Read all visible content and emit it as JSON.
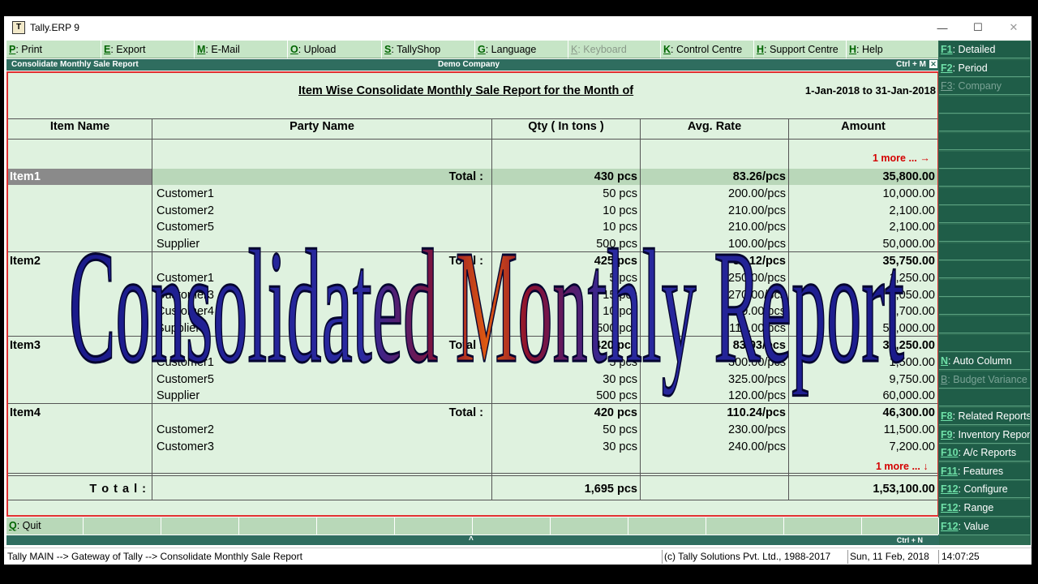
{
  "window": {
    "title": "Tally.ERP 9",
    "app_icon": "tally-icon"
  },
  "toolbar": [
    {
      "key": "P",
      "label": ": Print",
      "width": 117,
      "disabled": false
    },
    {
      "key": "E",
      "label": ": Export",
      "width": 115,
      "disabled": false
    },
    {
      "key": "M",
      "label": ": E-Mail",
      "width": 115,
      "disabled": false
    },
    {
      "key": "O",
      "label": ": Upload",
      "width": 116,
      "disabled": false
    },
    {
      "key": "S",
      "label": ": TallyShop",
      "width": 115,
      "disabled": false
    },
    {
      "key": "G",
      "label": ": Language",
      "width": 115,
      "disabled": false
    },
    {
      "key": "K",
      "label": ": Keyboard",
      "width": 114,
      "disabled": true
    },
    {
      "key": "K",
      "label": ": Control Centre",
      "width": 115,
      "disabled": false
    },
    {
      "key": "H",
      "label": ": Support Centre",
      "width": 114,
      "disabled": false
    },
    {
      "key": "H",
      "label": ": Help",
      "width": 114,
      "disabled": false
    }
  ],
  "infobar": {
    "left": "Consolidate Monthly Sale Report",
    "center": "Demo Company",
    "right": "Ctrl + M"
  },
  "report": {
    "title": "Item Wise Consolidate Monthly Sale Report for the Month of",
    "date_range": "1-Jan-2018 to 31-Jan-2018",
    "columns": [
      "Item Name",
      "Party Name",
      "Qty ( In tons )",
      "Avg. Rate",
      "Amount"
    ],
    "more_top": "1 more ... →",
    "more_bottom": "1 more ... ↓",
    "rows": [
      {
        "type": "item",
        "item": "Item1",
        "label": "Total :",
        "qty": "430 pcs",
        "rate": "83.26/pcs",
        "amount": "35,800.00",
        "shaded": true
      },
      {
        "type": "party",
        "party": "Customer1",
        "qty": "50 pcs",
        "rate": "200.00/pcs",
        "amount": "10,000.00"
      },
      {
        "type": "party",
        "party": "Customer2",
        "qty": "10 pcs",
        "rate": "210.00/pcs",
        "amount": "2,100.00"
      },
      {
        "type": "party",
        "party": "Customer5",
        "qty": "10 pcs",
        "rate": "210.00/pcs",
        "amount": "2,100.00"
      },
      {
        "type": "party",
        "party": "Supplier",
        "qty": "500 pcs",
        "rate": "100.00/pcs",
        "amount": "50,000.00"
      },
      {
        "type": "item",
        "item": "Item2",
        "label": "Total :",
        "qty": "425 pcs",
        "rate": "84.12/pcs",
        "amount": "35,750.00",
        "shaded": false
      },
      {
        "type": "party",
        "party": "Customer1",
        "qty": "5 pcs",
        "rate": "250.00/pcs",
        "amount": "1,250.00"
      },
      {
        "type": "party",
        "party": "Customer3",
        "qty": "15 pcs",
        "rate": "270.00/pcs",
        "amount": "4,050.00"
      },
      {
        "type": "party",
        "party": "Customer4",
        "qty": "10 pcs",
        "rate": "270.00/pcs",
        "amount": "2,700.00"
      },
      {
        "type": "party",
        "party": "Supplier",
        "qty": "500 pcs",
        "rate": "110.00/pcs",
        "amount": "55,000.00"
      },
      {
        "type": "item",
        "item": "Item3",
        "label": "Total :",
        "qty": "420 pcs",
        "rate": "83.93/pcs",
        "amount": "35,250.00",
        "shaded": false
      },
      {
        "type": "party",
        "party": "Customer1",
        "qty": "5 pcs",
        "rate": "300.00/pcs",
        "amount": "1,500.00"
      },
      {
        "type": "party",
        "party": "Customer5",
        "qty": "30 pcs",
        "rate": "325.00/pcs",
        "amount": "9,750.00"
      },
      {
        "type": "party",
        "party": "Supplier",
        "qty": "500 pcs",
        "rate": "120.00/pcs",
        "amount": "60,000.00"
      },
      {
        "type": "item",
        "item": "Item4",
        "label": "Total :",
        "qty": "420 pcs",
        "rate": "110.24/pcs",
        "amount": "46,300.00",
        "shaded": false
      },
      {
        "type": "party",
        "party": "Customer2",
        "qty": "50 pcs",
        "rate": "230.00/pcs",
        "amount": "11,500.00"
      },
      {
        "type": "party",
        "party": "Customer3",
        "qty": "30 pcs",
        "rate": "240.00/pcs",
        "amount": "7,200.00"
      }
    ],
    "grand_total": {
      "label": "T o t a l :",
      "qty": "1,695 pcs",
      "amount": "1,53,100.00"
    }
  },
  "right_panel": [
    {
      "key": "F1",
      "label": ": Detailed",
      "disabled": false
    },
    {
      "key": "F2",
      "label": ": Period",
      "disabled": false
    },
    {
      "key": "F3",
      "label": ": Company",
      "disabled": true
    },
    {
      "key": "",
      "label": "",
      "disabled": false
    },
    {
      "key": "",
      "label": "",
      "disabled": false
    },
    {
      "key": "",
      "label": "",
      "disabled": false
    },
    {
      "key": "",
      "label": "",
      "disabled": false
    },
    {
      "key": "",
      "label": "",
      "disabled": false
    },
    {
      "key": "",
      "label": "",
      "disabled": false
    },
    {
      "key": "",
      "label": "",
      "disabled": false
    },
    {
      "key": "",
      "label": "",
      "disabled": false
    },
    {
      "key": "",
      "label": "",
      "disabled": false
    },
    {
      "key": "",
      "label": "",
      "disabled": false
    },
    {
      "key": "",
      "label": "",
      "disabled": false
    },
    {
      "key": "",
      "label": "",
      "disabled": false
    },
    {
      "key": "",
      "label": "",
      "disabled": false
    },
    {
      "key": "",
      "label": "",
      "disabled": false
    },
    {
      "key": "N",
      "label": ": Auto Column",
      "disabled": false
    },
    {
      "key": "B",
      "label": ": Budget Variance",
      "disabled": true
    },
    {
      "key": "",
      "label": "",
      "disabled": false
    },
    {
      "key": "F8",
      "label": ": Related Reports",
      "disabled": false
    },
    {
      "key": "F9",
      "label": ": Inventory Reports",
      "disabled": false
    },
    {
      "key": "F10",
      "label": ": A/c Reports",
      "disabled": false
    },
    {
      "key": "F11",
      "label": ": Features",
      "disabled": false
    },
    {
      "key": "F12",
      "label": ": Configure",
      "disabled": false
    },
    {
      "key": "F12",
      "label": ": Range",
      "disabled": false
    },
    {
      "key": "F12",
      "label": ": Value",
      "disabled": false
    }
  ],
  "bottom_bar": {
    "quit_key": "Q",
    "quit_label": ": Quit",
    "ctrl_n": "Ctrl + N",
    "up_arrow": "˄"
  },
  "status": {
    "path": "Tally MAIN --> Gateway of Tally --> Consolidate Monthly Sale Report",
    "copyright": "(c) Tally Solutions Pvt. Ltd., 1988-2017",
    "date": "Sun, 11 Feb, 2018",
    "time": "14:07:25"
  },
  "watermark": {
    "text": "Consolidated Monthly Report"
  },
  "colors": {
    "report_bg": "#dff2df",
    "border_red": "#e03030",
    "panel_green": "#2c6b52",
    "more_red": "#d40000"
  }
}
